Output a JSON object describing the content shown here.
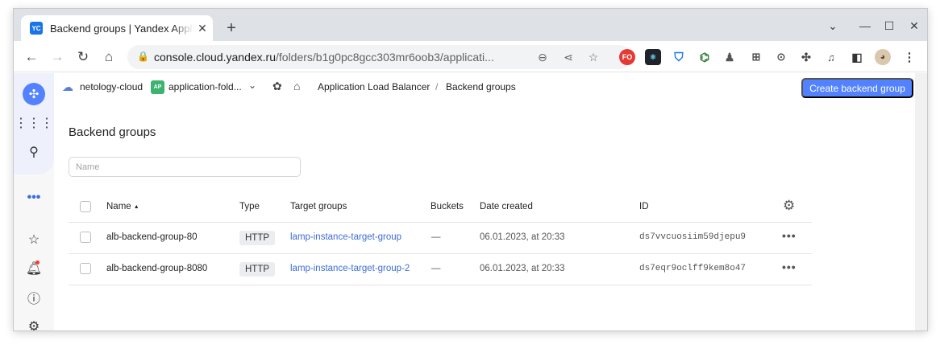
{
  "browser": {
    "tab_title": "Backend groups | Yandex Application Load Balancer",
    "tab_favicon_text": "YC",
    "url_host": "console.cloud.yandex.ru",
    "url_path": "/folders/b1g0pc8gcc303mr6oob3/applicati...",
    "extensions": [
      "FO",
      "react-icon",
      "shield-icon",
      "link-icon",
      "person-icon",
      "lock-icon",
      "code-icon",
      "puzzle-icon",
      "music-list-icon",
      "sidebar-icon",
      "avatar"
    ]
  },
  "breadcrumb": {
    "cloud": "netology-cloud",
    "folder_badge": "AP",
    "folder": "application-fold...",
    "service": "Application Load Balancer",
    "separator": "/",
    "current": "Backend groups"
  },
  "create_button": "Create backend group",
  "page_title": "Backend groups",
  "filter": {
    "placeholder": "Name",
    "value": ""
  },
  "table": {
    "columns": [
      "Name",
      "Type",
      "Target groups",
      "Buckets",
      "Date created",
      "ID"
    ],
    "rows": [
      {
        "name": "alb-backend-group-80",
        "type": "HTTP",
        "target_groups": "lamp-instance-target-group",
        "buckets": "—",
        "date_created": "06.01.2023, at 20:33",
        "id": "ds7vvcuosiim59djepu9"
      },
      {
        "name": "alb-backend-group-8080",
        "type": "HTTP",
        "target_groups": "lamp-instance-target-group-2",
        "buckets": "—",
        "date_created": "06.01.2023, at 20:33",
        "id": "ds7eqr9oclff9kem8o47"
      }
    ]
  },
  "colors": {
    "accent": "#5282ff",
    "link": "#3d6dd6"
  }
}
